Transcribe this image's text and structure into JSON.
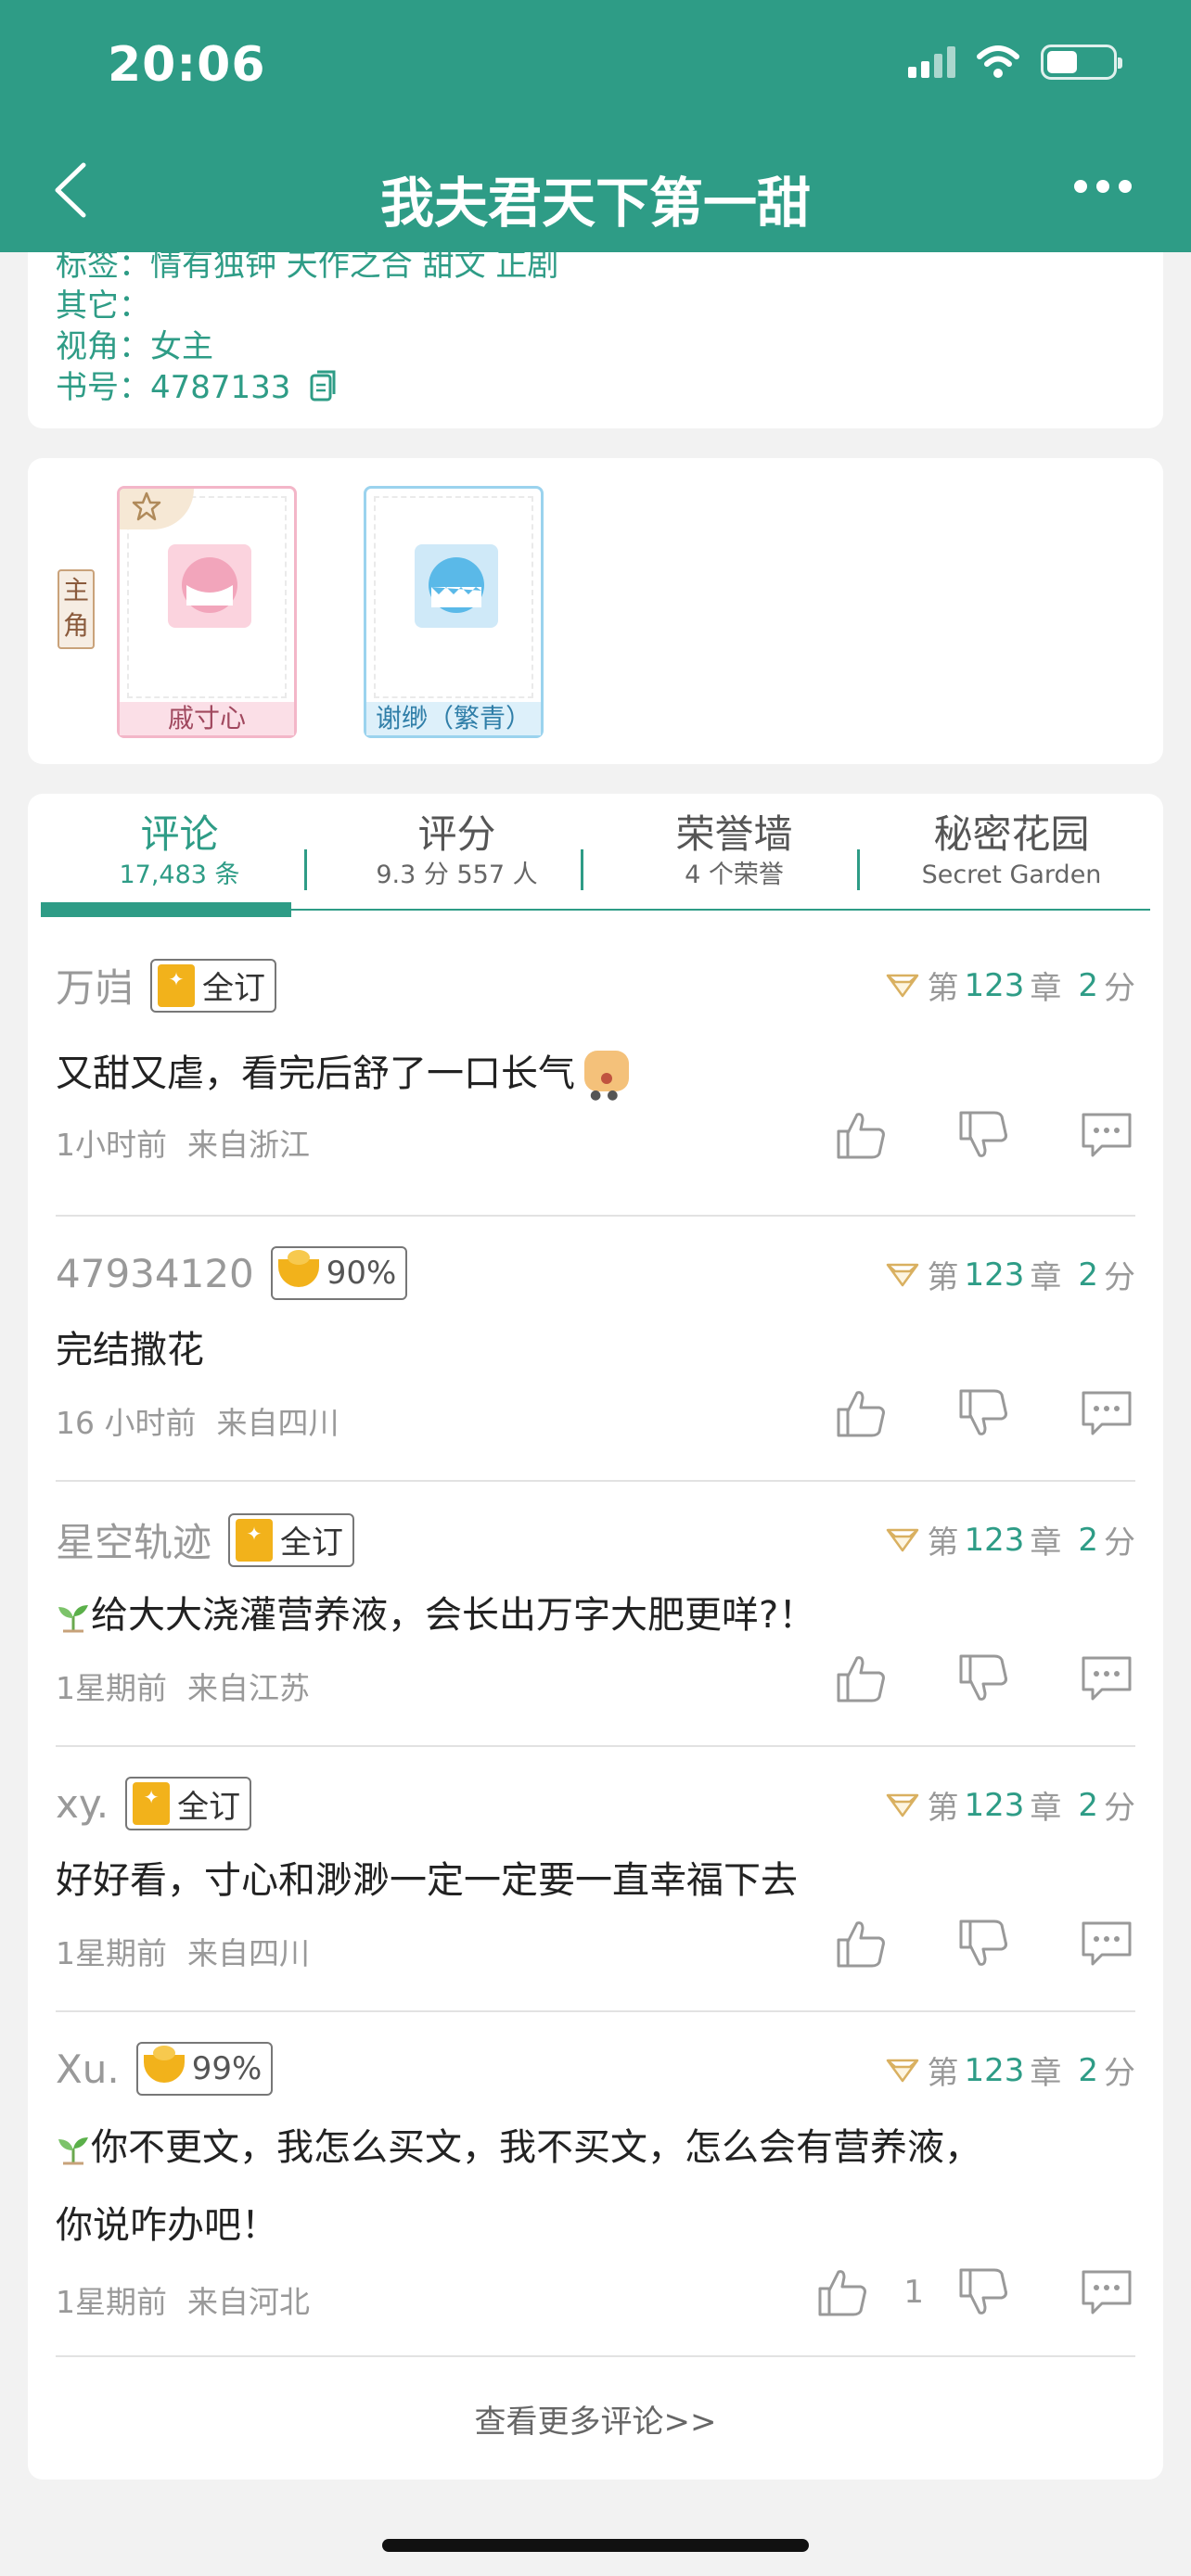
{
  "status_bar": {
    "time": "20:06"
  },
  "nav": {
    "title": "我夫君天下第一甜"
  },
  "info": {
    "tags_label": "标签：",
    "tags_value": "情有独钟  天作之合  甜文  正剧",
    "other_label": "其它：",
    "other_value": "",
    "pov_label": "视角：",
    "pov_value": "女主",
    "book_id_label": "书号：",
    "book_id_value": "4787133"
  },
  "characters": {
    "role_label": "主角",
    "items": [
      {
        "name": "戚寸心"
      },
      {
        "name": "谢缈（繁青）"
      }
    ]
  },
  "tabs": [
    {
      "label": "评论",
      "sub": "17,483 条"
    },
    {
      "label": "评分",
      "sub": "9.3 分 557 人"
    },
    {
      "label": "荣誉墙",
      "sub": "4 个荣誉"
    },
    {
      "label": "秘密花园",
      "sub": "Secret Garden"
    }
  ],
  "comments": [
    {
      "user": "万岿",
      "badge": "全订",
      "chapter_prefix": "第",
      "chapter": "123",
      "chapter_suffix": "章",
      "score": "2",
      "score_suffix": "分",
      "text": "又甜又虐，看完后舒了一口长气",
      "time": "1小时前",
      "location": "来自浙江",
      "likes": ""
    },
    {
      "user": "47934120",
      "badge": "90%",
      "chapter_prefix": "第",
      "chapter": "123",
      "chapter_suffix": "章",
      "score": "2",
      "score_suffix": "分",
      "text": "完结撒花",
      "time": "16 小时前",
      "location": "来自四川",
      "likes": ""
    },
    {
      "user": "星空轨迹",
      "badge": "全订",
      "chapter_prefix": "第",
      "chapter": "123",
      "chapter_suffix": "章",
      "score": "2",
      "score_suffix": "分",
      "text": "给大大浇灌营养液，会长出万字大肥更咩?！",
      "time": "1星期前",
      "location": "来自江苏",
      "likes": ""
    },
    {
      "user": "xy.",
      "badge": "全订",
      "chapter_prefix": "第",
      "chapter": "123",
      "chapter_suffix": "章",
      "score": "2",
      "score_suffix": "分",
      "text": "好好看，寸心和渺渺一定一定要一直幸福下去",
      "time": "1星期前",
      "location": "来自四川",
      "likes": ""
    },
    {
      "user": "Xu.",
      "badge": "99%",
      "chapter_prefix": "第",
      "chapter": "123",
      "chapter_suffix": "章",
      "score": "2",
      "score_suffix": "分",
      "text": "你不更文，我怎么买文，我不买文，怎么会有营养液，",
      "text2": "你说咋办吧！",
      "time": "1星期前",
      "location": "来自河北",
      "likes": "1"
    }
  ],
  "more_comments": "查看更多评论>>",
  "colors": {
    "brand": "#2e9c86",
    "badge_gold": "#f2b21b"
  },
  "icons": [
    "back-arrow-icon",
    "more-dots-icon",
    "signal-icon",
    "wifi-icon",
    "battery-icon",
    "copy-icon",
    "star-icon",
    "diamond-icon",
    "bookmark-icon",
    "gold-ingot-icon",
    "thumbs-up-icon",
    "thumbs-down-icon",
    "comment-bubble-icon",
    "sprout-icon",
    "emoji-face-icon"
  ]
}
